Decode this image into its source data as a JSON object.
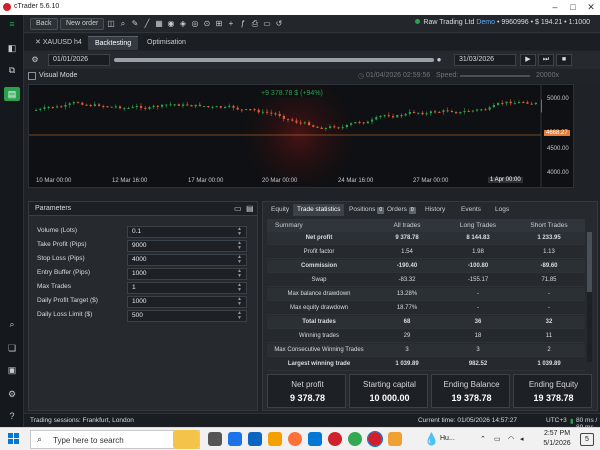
{
  "window": {
    "title": "cTrader 5.6.10"
  },
  "toolbar": {
    "back_label": "Back",
    "new_order_label": "New order",
    "account_info": "Raw Trading Ltd",
    "account_mode": "Demo",
    "account_number": "9960996",
    "balance": "$ 194.21",
    "leverage": "1:1000"
  },
  "sidebar": {
    "items": [
      {
        "icon": "chart-icon"
      },
      {
        "icon": "copy-icon"
      },
      {
        "icon": "algo-icon"
      },
      {
        "icon": "search-analytics-icon"
      },
      {
        "icon": "bookmark-icon"
      },
      {
        "icon": "wallet-icon"
      },
      {
        "icon": "settings-icon"
      },
      {
        "icon": "help-icon"
      }
    ]
  },
  "tabs": {
    "symbol": "XAUUSD h4",
    "items": [
      "Backtesting",
      "Optimisation"
    ]
  },
  "backtest": {
    "start_date": "01/01/2026",
    "end_date": "31/03/2026",
    "progress_fraction": 1.0,
    "visual_mode_label": "Visual Mode",
    "current_time": "01/04/2026 02:59:56",
    "speed_label": "Speed:",
    "speed_value": "20000x"
  },
  "chart": {
    "equity_label": "+9 378.78 $ (+94%)",
    "price_tag": "4668.27",
    "price_labels": [
      "5000.00",
      "4500.00",
      "4000.00"
    ],
    "x_labels": [
      "10 Mar 00:00",
      "12 Mar 16:00",
      "17 Mar 00:00",
      "20 Mar 00:00",
      "24 Mar 16:00",
      "27 Mar 00:00",
      "1 Apr 00:00"
    ],
    "up_color": "#2aa14c",
    "down_color": "#e35b3a"
  },
  "parameters": {
    "title": "Parameters",
    "rows": [
      {
        "label": "Volume (Lots)",
        "value": "0.1"
      },
      {
        "label": "Take Profit (Pips)",
        "value": "9000"
      },
      {
        "label": "Stop Loss (Pips)",
        "value": "4000"
      },
      {
        "label": "Entry Buffer (Pips)",
        "value": "1000"
      },
      {
        "label": "Max Trades",
        "value": "1"
      },
      {
        "label": "Daily Profit Target ($)",
        "value": "1000"
      },
      {
        "label": "Daily Loss Limit ($)",
        "value": "500"
      }
    ]
  },
  "results": {
    "tabs": [
      {
        "label": "Equity",
        "badge": ""
      },
      {
        "label": "Trade statistics",
        "badge": ""
      },
      {
        "label": "Positions",
        "badge": "0"
      },
      {
        "label": "Orders",
        "badge": "0"
      },
      {
        "label": "History",
        "badge": ""
      },
      {
        "label": "Events",
        "badge": ""
      },
      {
        "label": "Logs",
        "badge": ""
      }
    ],
    "columns": [
      "Summary",
      "All trades",
      "Long Trades",
      "Short Trades"
    ],
    "rows": [
      {
        "name": "Net profit",
        "all": "9 378.78",
        "long": "8 144.83",
        "short": "1 233.95",
        "bold": true
      },
      {
        "name": "Profit factor",
        "all": "1.54",
        "long": "1.98",
        "short": "1.13"
      },
      {
        "name": "Commission",
        "all": "-190.40",
        "long": "-100.80",
        "short": "-89.60",
        "bold": true
      },
      {
        "name": "Swap",
        "all": "-83.32",
        "long": "-155.17",
        "short": "71.85"
      },
      {
        "name": "Max balance drawdown",
        "all": "13.28%",
        "long": "-",
        "short": "-"
      },
      {
        "name": "Max equity drawdown",
        "all": "18.77%",
        "long": "-",
        "short": "-"
      },
      {
        "name": "Total trades",
        "all": "68",
        "long": "36",
        "short": "32",
        "bold": true
      },
      {
        "name": "Winning trades",
        "all": "29",
        "long": "18",
        "short": "11"
      },
      {
        "name": "Max Consecutive Winning Trades",
        "all": "3",
        "long": "3",
        "short": "2"
      },
      {
        "name": "Largest winning trade",
        "all": "1 039.89",
        "long": "982.52",
        "short": "1 039.89",
        "bold": true
      }
    ],
    "summary": [
      {
        "label": "Net profit",
        "value": "9 378.78"
      },
      {
        "label": "Starting capital",
        "value": "10 000.00"
      },
      {
        "label": "Ending Balance",
        "value": "19 378.78"
      },
      {
        "label": "Ending Equity",
        "value": "19 378.78"
      }
    ]
  },
  "statusbar": {
    "sessions": "Trading sessions: Frankfurt, London",
    "current_time": "Current time: 01/05/2026 14:57:27",
    "timezone": "UTC+3",
    "latency": "80 ms / 80 ms"
  },
  "taskbar": {
    "search_placeholder": "Type here to search",
    "weather": "Hu...",
    "time": "2:57 PM",
    "date": "5/1/2026",
    "notification_count": "5"
  }
}
